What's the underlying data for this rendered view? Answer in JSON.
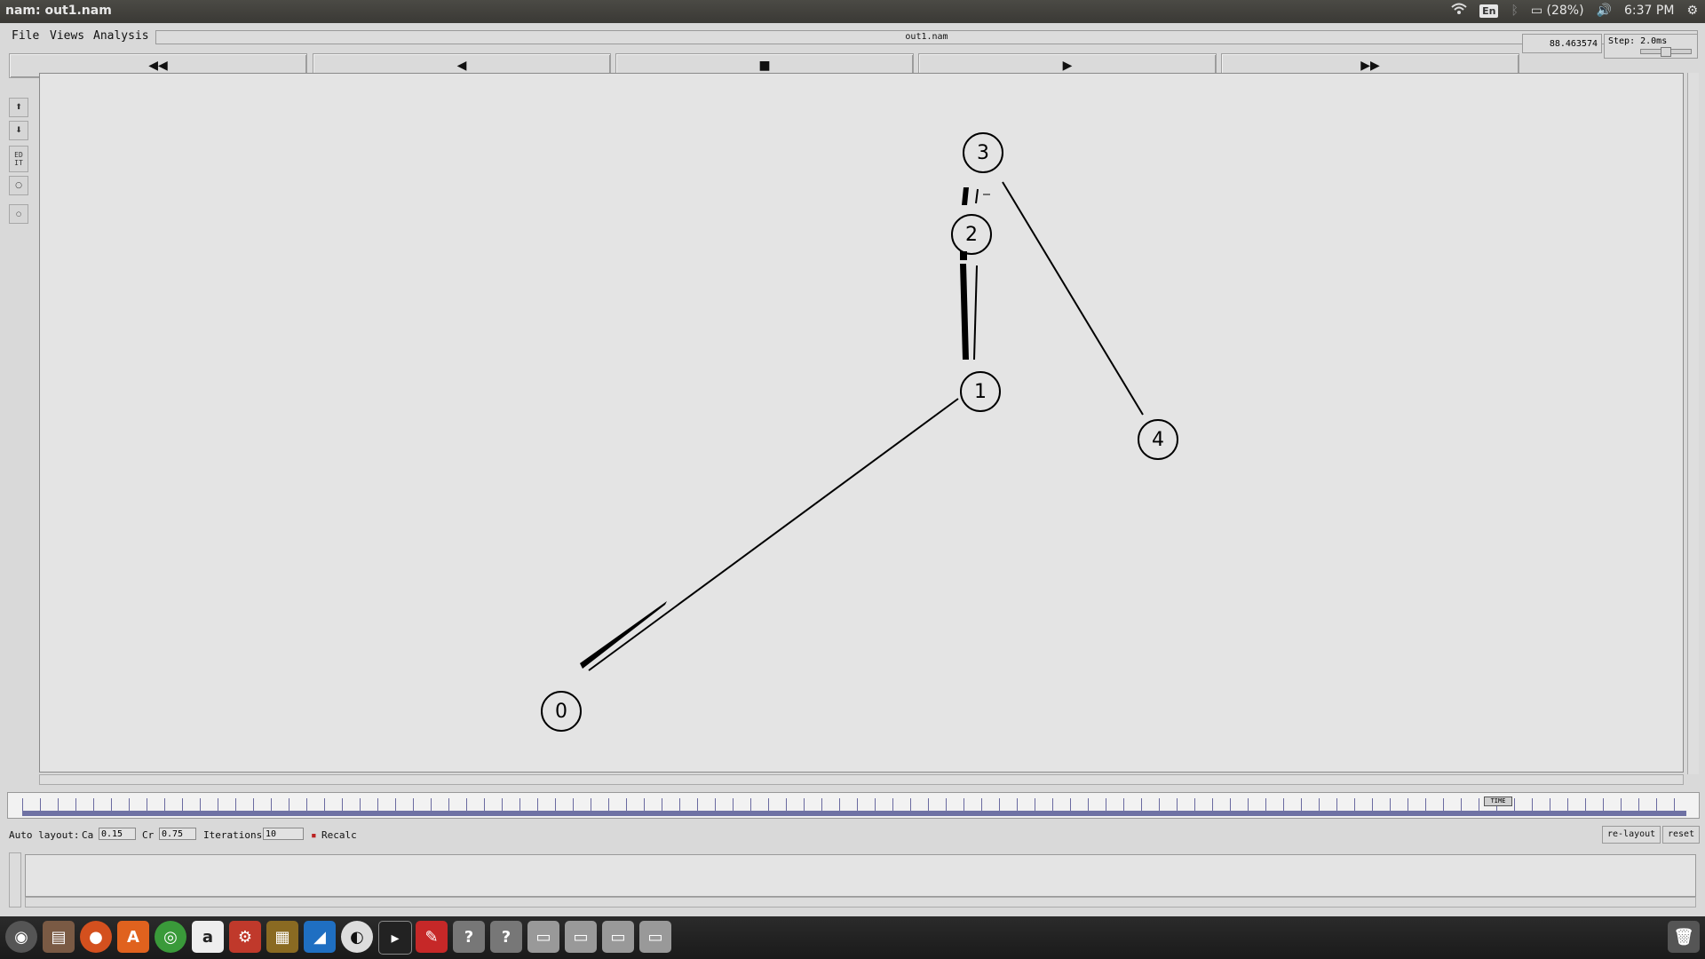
{
  "topbar": {
    "title": "nam: out1.nam",
    "lang": "En",
    "battery": "(28%)",
    "time": "6:37 PM"
  },
  "menu": {
    "file": "File",
    "views": "Views",
    "analysis": "Analysis"
  },
  "filename": "out1.nam",
  "controls": {
    "rewind": "◀◀",
    "back": "◀",
    "stop": "■",
    "play": "▶",
    "fastforward": "▶▶"
  },
  "time_display": "88.463574",
  "step": "Step: 2.0ms",
  "nodes": [
    {
      "id": "0"
    },
    {
      "id": "1"
    },
    {
      "id": "2"
    },
    {
      "id": "3"
    },
    {
      "id": "4"
    }
  ],
  "timeline_marker": "TIME",
  "autolayout": {
    "label": "Auto layout:",
    "ca_label": "Ca",
    "ca_value": "0.15",
    "cr_label": "Cr",
    "cr_value": "0.75",
    "iter_label": "Iterations",
    "iter_value": "10",
    "recalc": "Recalc",
    "relayout": "re-layout",
    "reset": "reset"
  },
  "icons": {
    "wifi": "wifi-icon",
    "bluetooth": "bluetooth-icon",
    "battery": "battery-icon",
    "volume": "volume-icon",
    "settings": "gear-icon"
  },
  "dock_colors": {
    "accent": "#3c8f4c",
    "dock_bg": "#1a1a1a"
  }
}
